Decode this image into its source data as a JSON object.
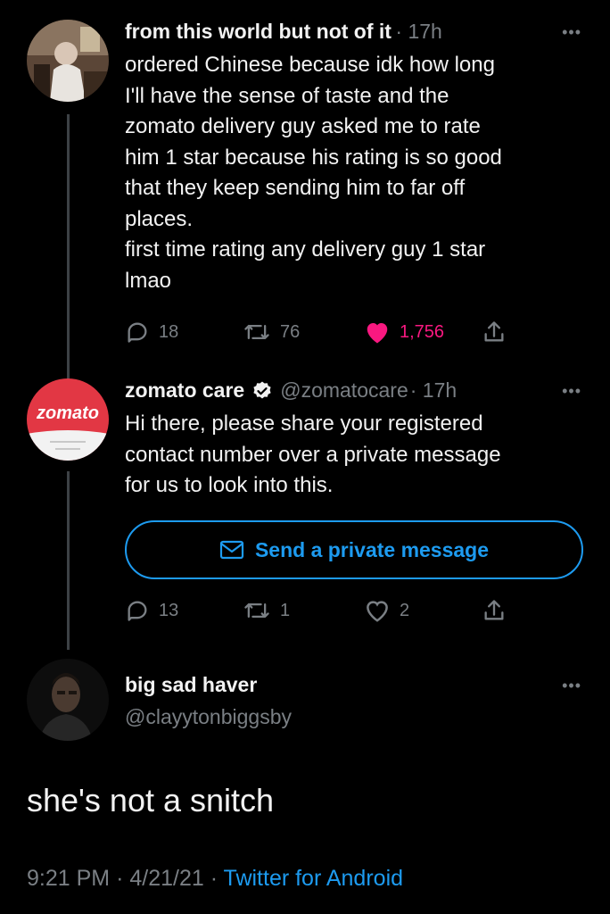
{
  "tweet1": {
    "name": "from this world but not of it",
    "time": "· 17h",
    "more": "•••",
    "lines": [
      "ordered Chinese because idk how long",
      "I'll have the sense of taste and the",
      "zomato delivery guy asked me to rate",
      "him 1 star because his rating is so good",
      "that they keep sending him to far off",
      "places.",
      "first time rating any delivery guy 1 star",
      "lmao"
    ],
    "replies": "18",
    "retweets": "76",
    "likes": "1,756"
  },
  "tweet2": {
    "name": "zomato care",
    "handle": "@zomatocare",
    "time": "· 17h",
    "more": "•••",
    "avatar_text": "zomato",
    "lines": [
      "Hi there, please share your registered",
      "contact number over a private message",
      "for us to look into this."
    ],
    "button_label": "Send a private message",
    "replies": "13",
    "retweets": "1",
    "likes": "2"
  },
  "tweet3": {
    "name": "big sad haver",
    "handle": "@clayytonbiggsby",
    "more": "•••",
    "text": "she's not a snitch",
    "time": "9:21 PM",
    "date": "4/21/21",
    "source": "Twitter for Android",
    "sep": "·"
  },
  "colors": {
    "background": "#000000",
    "accent": "#1d9bf0",
    "like": "#f91880",
    "zomato_red": "#e23744"
  }
}
